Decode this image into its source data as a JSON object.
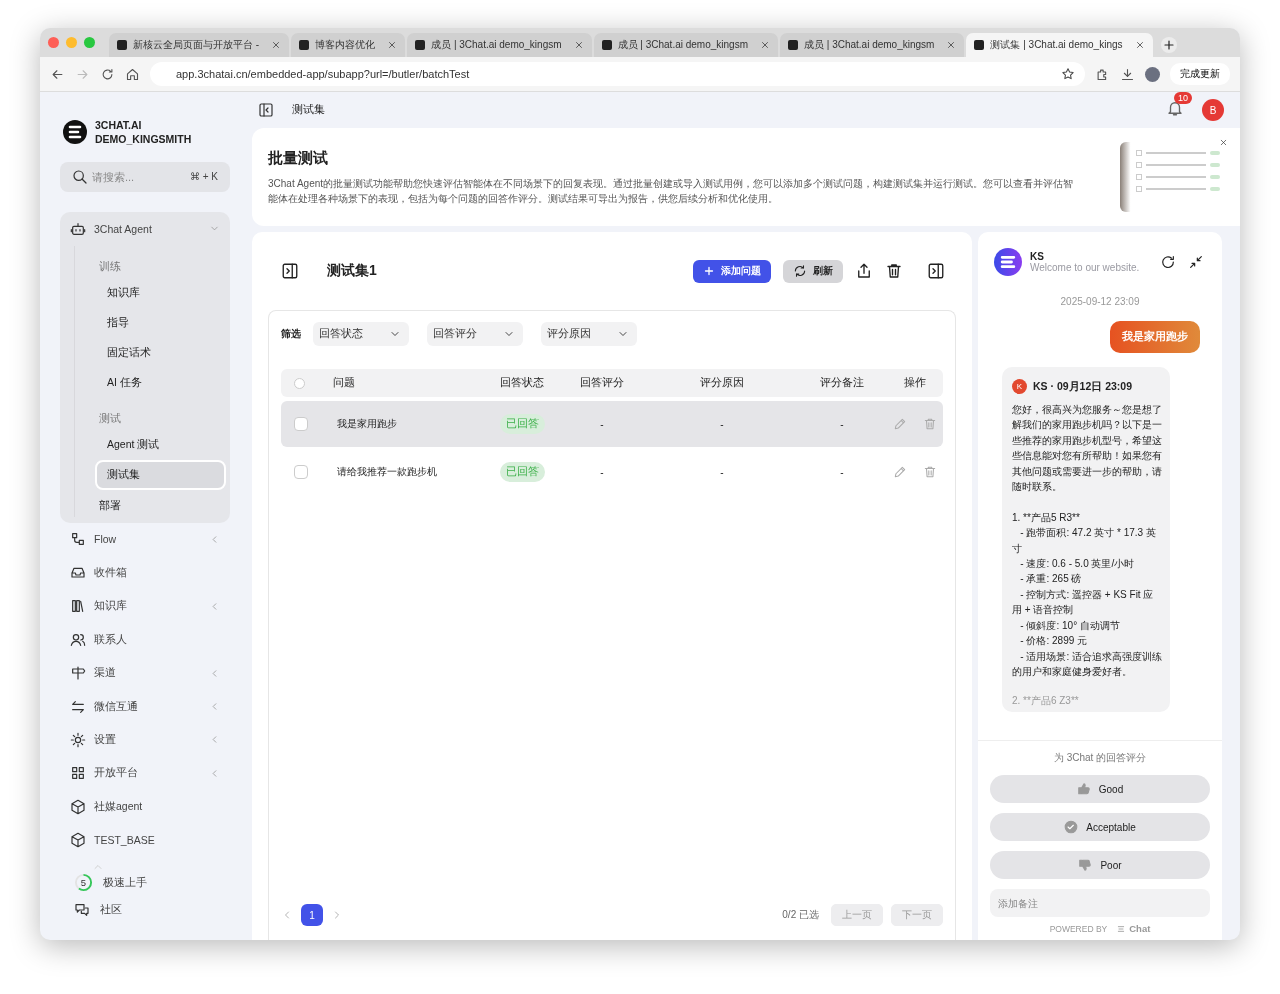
{
  "browser": {
    "tabs": [
      {
        "title": "新核云全局页面与开放平台 - ",
        "selected": false
      },
      {
        "title": "博客内容优化",
        "selected": false
      },
      {
        "title": "成员 | 3Chat.ai demo_kingsm",
        "selected": false
      },
      {
        "title": "成员 | 3Chat.ai demo_kingsm",
        "selected": false
      },
      {
        "title": "成员 | 3Chat.ai demo_kingsm",
        "selected": false
      },
      {
        "title": "测试集 | 3Chat.ai demo_kings",
        "selected": true
      }
    ],
    "url": "app.3chatai.cn/embedded-app/subapp?url=/butler/batchTest",
    "update_button": "完成更新"
  },
  "sidebar": {
    "workspace": [
      "3CHAT.AI",
      "DEMO_KINGSMITH"
    ],
    "search": {
      "placeholder": "请搜索...",
      "shortcut": "⌘ + K"
    },
    "group": {
      "label": "3Chat Agent",
      "expanded": true,
      "children": [
        {
          "kind": "header",
          "label": "训练"
        },
        {
          "kind": "item",
          "label": "知识库",
          "selected": false
        },
        {
          "kind": "item",
          "label": "指导",
          "selected": false
        },
        {
          "kind": "item",
          "label": "固定话术",
          "selected": false
        },
        {
          "kind": "item",
          "label": "AI 任务",
          "selected": false
        },
        {
          "kind": "header",
          "label": "测试"
        },
        {
          "kind": "item",
          "label": "Agent 测试",
          "selected": false
        },
        {
          "kind": "item",
          "label": "测试集",
          "selected": true
        },
        {
          "kind": "top",
          "label": "部署"
        }
      ]
    },
    "items": [
      {
        "label": "Flow",
        "has_children": true
      },
      {
        "label": "收件箱",
        "has_children": false
      },
      {
        "label": "知识库",
        "has_children": true
      },
      {
        "label": "联系人",
        "has_children": false
      },
      {
        "label": "渠道",
        "has_children": true
      },
      {
        "label": "微信互通",
        "has_children": true
      },
      {
        "label": "设置",
        "has_children": true
      },
      {
        "label": "开放平台",
        "has_children": true
      },
      {
        "label": "社媒agent",
        "has_children": false
      },
      {
        "label": "TEST_BASE",
        "has_children": false
      }
    ],
    "onboarding": {
      "count": "5",
      "level": 0.6,
      "label": "极速上手"
    },
    "community": "社区"
  },
  "topbar": {
    "breadcrumb": "测试集",
    "notifications": "10",
    "avatar": "B"
  },
  "banner": {
    "title": "批量测试",
    "description": "3Chat Agent的批量测试功能帮助您快速评估智能体在不同场景下的回复表现。通过批量创建或导入测试用例，您可以添加多个测试问题，构建测试集并运行测试。您可以查看并评估智能体在处理各种场景下的表现，包括为每个问题的回答作评分。测试结果可导出为报告，供您后续分析和优化使用。"
  },
  "testset": {
    "title": "测试集1",
    "add_button": "添加问题",
    "refresh_button": "刷新",
    "filter_label": "筛选",
    "all_checked": false,
    "filters": [
      "回答状态",
      "回答评分",
      "评分原因"
    ],
    "columns": [
      "问题",
      "回答状态",
      "回答评分",
      "评分原因",
      "评分备注",
      "操作"
    ],
    "rows": [
      {
        "question": "我是家用跑步",
        "status": "已回答",
        "rating": "-",
        "reason": "-",
        "note": "-",
        "selected": true,
        "checked": false
      },
      {
        "question": "请给我推荐一款跑步机",
        "status": "已回答",
        "rating": "-",
        "reason": "-",
        "note": "-",
        "selected": false,
        "checked": false
      }
    ],
    "pagination": {
      "pages": [
        {
          "label": "1",
          "selected": true
        }
      ],
      "selection": "0/2 已选",
      "prev": "上一页",
      "next": "下一页",
      "disabled": true
    }
  },
  "chat": {
    "name": "KS",
    "subtitle": "Welcome to our website.",
    "timestamp": "2025-09-12 23:09",
    "user_message": "我是家用跑步",
    "reply": {
      "avatar": "K",
      "header": "KS · 09月12日 23:09",
      "body": "您好，很高兴为您服务～您是想了解我们的家用跑步机吗？以下是一些推荐的家用跑步机型号，希望这些信息能对您有所帮助！如果您有其他问题或需要进一步的帮助，请随时联系。\n\n1. **产品5 R3**\n   - 跑带面积: 47.2 英寸 * 17.3 英寸\n   - 速度: 0.6 - 5.0 英里/小时\n   - 承重: 265 磅\n   - 控制方式: 遥控器 + KS Fit 应用 + 语音控制\n   - 倾斜度: 10° 自动调节\n   - 价格: 2899 元\n   - 适用场景: 适合追求高强度训练的用户和家庭健身爱好者。",
      "faded_line": "2. **产品6 Z3**"
    },
    "rating_prompt": "为 3Chat 的回答评分",
    "ratings": [
      {
        "kind": "good",
        "label": "Good"
      },
      {
        "kind": "acceptable",
        "label": "Acceptable"
      },
      {
        "kind": "poor",
        "label": "Poor"
      }
    ],
    "note": {
      "placeholder": "添加备注"
    },
    "powered_by": "POWERED BY",
    "brand": "Chat"
  }
}
